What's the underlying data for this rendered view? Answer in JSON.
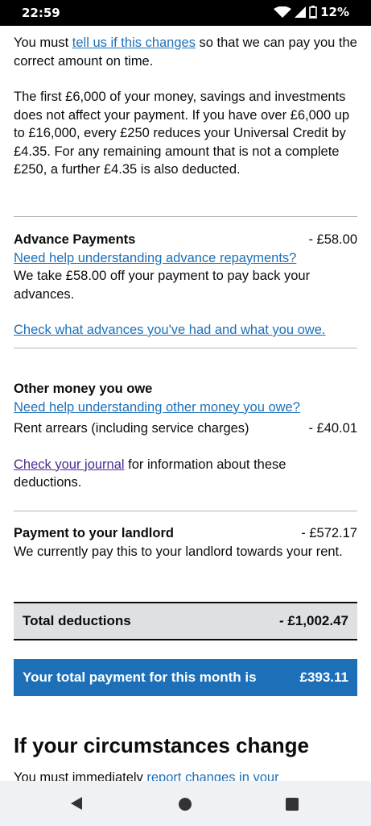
{
  "status_bar": {
    "time": "22:59",
    "battery": "12%",
    "icons": [
      "wifi-icon",
      "signal-icon",
      "battery-icon"
    ]
  },
  "intro": {
    "line1_before": "You must ",
    "line1_link": "tell us if this changes",
    "line1_after": " so that we can pay you the correct amount on time.",
    "savings_text": "The first £6,000 of your money, savings and investments does not affect your payment. If you have over £6,000 up to £16,000, every £250 reduces your Universal Credit by £4.35. For any remaining amount that is not a complete £250, a further £4.35 is also deducted."
  },
  "advance_payments": {
    "title": "Advance Payments",
    "amount": "- £58.00",
    "help_link": "Need help understanding advance repayments?",
    "description": "We take £58.00 off your payment to pay back your advances.",
    "check_link": "Check what advances you've had and what you owe."
  },
  "other_money": {
    "title": "Other money you owe",
    "help_link": "Need help understanding other money you owe?",
    "row_label": "Rent arrears (including service charges)",
    "row_amount": "- £40.01",
    "journal_link": "Check your journal",
    "journal_after": " for information about these deductions."
  },
  "landlord": {
    "title": "Payment to your landlord",
    "amount": "- £572.17",
    "description": "We currently pay this to your landlord towards your rent."
  },
  "totals": {
    "deductions_label": "Total deductions",
    "deductions_amount": "- £1,002.47",
    "payment_label": "Your total payment for this month is",
    "payment_amount": "£393.11"
  },
  "circumstances": {
    "heading": "If your circumstances change",
    "text_before": "You must immediately ",
    "text_link": "report changes in your"
  },
  "nav": {
    "back": "back-icon",
    "home": "home-icon",
    "recent": "recent-apps-icon"
  },
  "colors": {
    "link": "#1d70b8",
    "visited_link": "#4c2c92",
    "total_bg": "#dee0e2",
    "payment_bg": "#1d70b8"
  }
}
